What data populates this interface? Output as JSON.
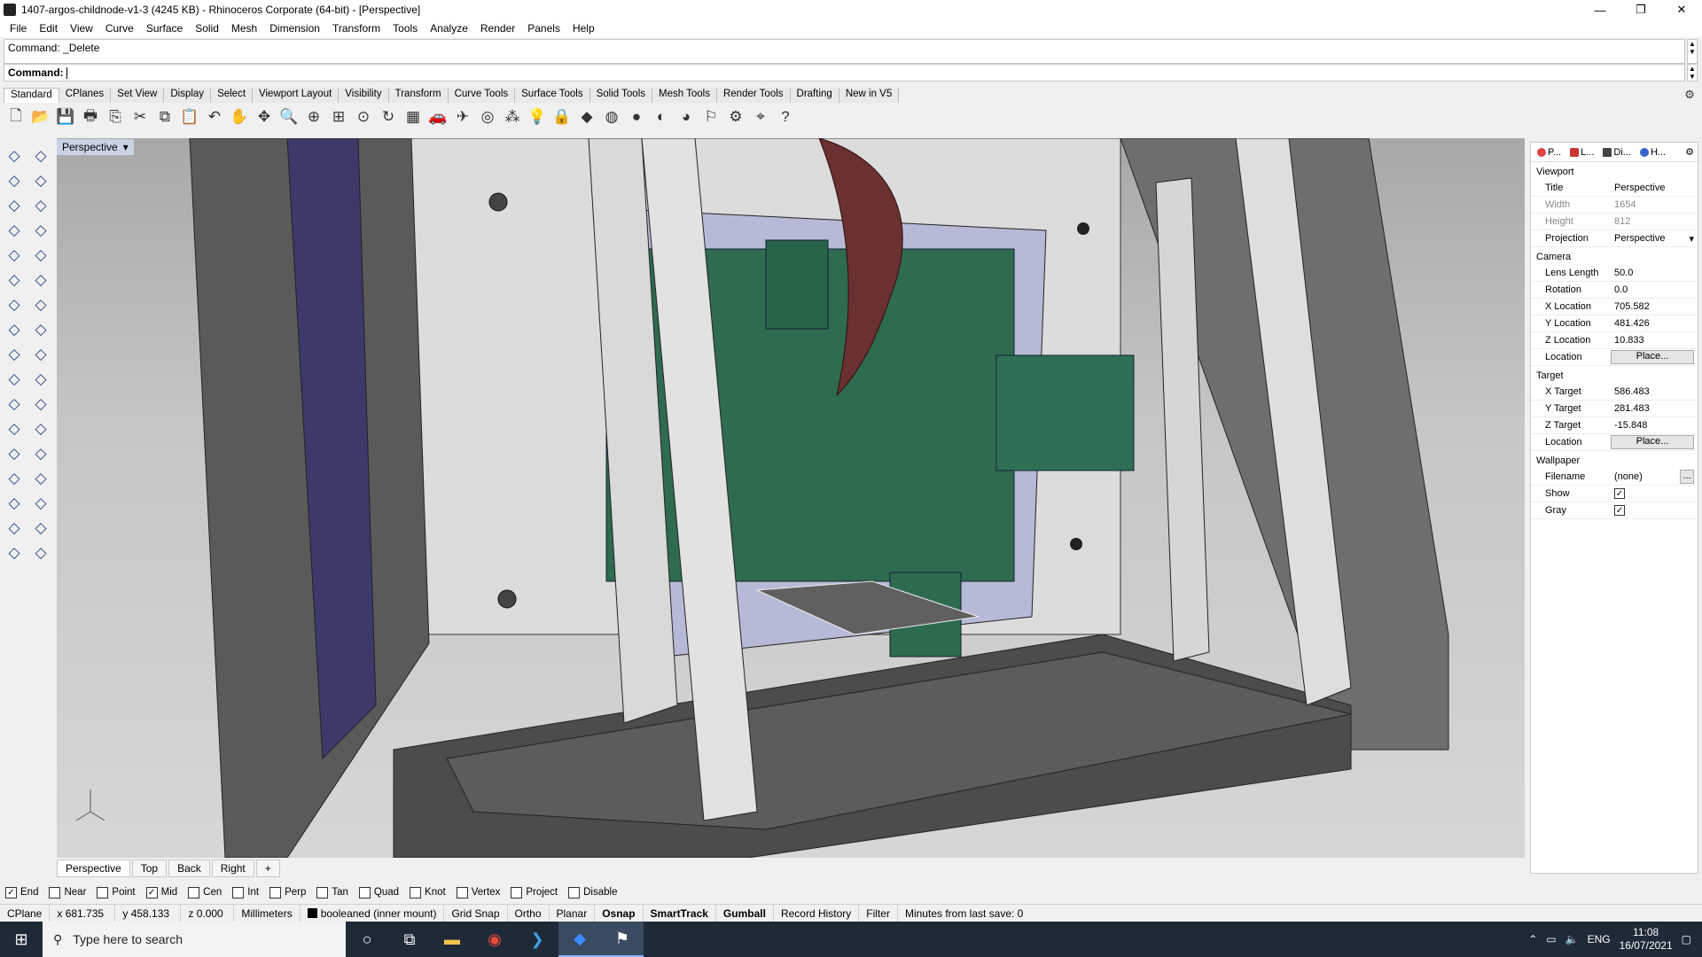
{
  "window": {
    "title": "1407-argos-childnode-v1-3 (4245 KB) - Rhinoceros Corporate (64-bit) - [Perspective]",
    "controls": [
      "minimize-icon",
      "restore-icon",
      "close-icon"
    ]
  },
  "menu": [
    "File",
    "Edit",
    "View",
    "Curve",
    "Surface",
    "Solid",
    "Mesh",
    "Dimension",
    "Transform",
    "Tools",
    "Analyze",
    "Render",
    "Panels",
    "Help"
  ],
  "command": {
    "history": "Command: _Delete",
    "prompt": "Command:"
  },
  "toolbar_tabs": [
    "Standard",
    "CPlanes",
    "Set View",
    "Display",
    "Select",
    "Viewport Layout",
    "Visibility",
    "Transform",
    "Curve Tools",
    "Surface Tools",
    "Solid Tools",
    "Mesh Tools",
    "Render Tools",
    "Drafting",
    "New in V5"
  ],
  "toolbar_icons": [
    {
      "name": "new-file-icon",
      "glyph": "🗋"
    },
    {
      "name": "open-folder-icon",
      "glyph": "📂"
    },
    {
      "name": "save-icon",
      "glyph": "💾"
    },
    {
      "name": "print-icon",
      "glyph": "🖶"
    },
    {
      "name": "export-icon",
      "glyph": "⎘"
    },
    {
      "name": "cut-icon",
      "glyph": "✂"
    },
    {
      "name": "copy-icon",
      "glyph": "⧉"
    },
    {
      "name": "paste-icon",
      "glyph": "📋"
    },
    {
      "name": "undo-icon",
      "glyph": "↶"
    },
    {
      "name": "pan-hand-icon",
      "glyph": "✋"
    },
    {
      "name": "rotate-view-icon",
      "glyph": "✥"
    },
    {
      "name": "zoom-icon",
      "glyph": "🔍"
    },
    {
      "name": "zoom-window-icon",
      "glyph": "⊕"
    },
    {
      "name": "zoom-extents-icon",
      "glyph": "⊞"
    },
    {
      "name": "zoom-selected-icon",
      "glyph": "⊙"
    },
    {
      "name": "undo-view-icon",
      "glyph": "↻"
    },
    {
      "name": "four-viewports-icon",
      "glyph": "▦"
    },
    {
      "name": "named-views-icon",
      "glyph": "🚗"
    },
    {
      "name": "named-cplanes-icon",
      "glyph": "✈"
    },
    {
      "name": "set-cplane-icon",
      "glyph": "◎"
    },
    {
      "name": "snapshots-icon",
      "glyph": "⁂"
    },
    {
      "name": "light-bulb-icon",
      "glyph": "💡"
    },
    {
      "name": "lock-icon",
      "glyph": "🔒"
    },
    {
      "name": "layer-icon",
      "glyph": "◆"
    },
    {
      "name": "color-wheel-icon",
      "glyph": "◍"
    },
    {
      "name": "shaded-sphere-icon",
      "glyph": "●"
    },
    {
      "name": "rendered-sphere-icon",
      "glyph": "◐"
    },
    {
      "name": "render-icon",
      "glyph": "◕"
    },
    {
      "name": "options-icon",
      "glyph": "⚐"
    },
    {
      "name": "gear-options-icon",
      "glyph": "⚙"
    },
    {
      "name": "grasshopper-icon",
      "glyph": "⌖"
    },
    {
      "name": "help-icon",
      "glyph": "?"
    }
  ],
  "left_tools": [
    "select-arrow-icon",
    "point-icon",
    "polyline-icon",
    "curve-icon",
    "circle-icon",
    "ellipse-icon",
    "polygon-icon",
    "rectangle-icon",
    "arc-icon",
    "curve-edit-icon",
    "surface-corner-icon",
    "surface-edit-icon",
    "box-icon",
    "sphere-icon",
    "cylinder-icon",
    "solid-edit-icon",
    "mesh-icon",
    "explode-icon",
    "boolean-icon",
    "split-icon",
    "fillet-icon",
    "blend-icon",
    "dimension-icon",
    "move-icon",
    "array-icon",
    "gumball-icon",
    "extrude-icon",
    "ruler-icon",
    "grid-array-icon",
    "transform-icon",
    "analyze-icon",
    "checkmark-icon",
    "render-mesh-icon",
    "light-icon"
  ],
  "viewport": {
    "label": "Perspective",
    "tabs": [
      "Perspective",
      "Top",
      "Back",
      "Right"
    ],
    "add_tab": "+"
  },
  "properties": {
    "tabs": [
      "P...",
      "L...",
      "Di...",
      "H..."
    ],
    "viewport_header": "Viewport",
    "viewport": [
      {
        "k": "Title",
        "v": "Perspective",
        "dim": false
      },
      {
        "k": "Width",
        "v": "1654",
        "dim": true
      },
      {
        "k": "Height",
        "v": "812",
        "dim": true
      },
      {
        "k": "Projection",
        "v": "Perspective",
        "dim": false
      }
    ],
    "camera_header": "Camera",
    "camera": [
      {
        "k": "Lens Length",
        "v": "50.0"
      },
      {
        "k": "Rotation",
        "v": "0.0"
      },
      {
        "k": "X Location",
        "v": "705.582"
      },
      {
        "k": "Y Location",
        "v": "481.426"
      },
      {
        "k": "Z Location",
        "v": "10.833"
      }
    ],
    "camera_location_label": "Location",
    "place_button": "Place...",
    "target_header": "Target",
    "target": [
      {
        "k": "X Target",
        "v": "586.483"
      },
      {
        "k": "Y Target",
        "v": "281.483"
      },
      {
        "k": "Z Target",
        "v": "-15.848"
      }
    ],
    "target_location_label": "Location",
    "wallpaper_header": "Wallpaper",
    "filename_label": "Filename",
    "filename_value": "(none)",
    "browse": "...",
    "show_label": "Show",
    "gray_label": "Gray",
    "show_checked": true,
    "gray_checked": true
  },
  "osnaps": [
    {
      "label": "End",
      "checked": true
    },
    {
      "label": "Near",
      "checked": false
    },
    {
      "label": "Point",
      "checked": false
    },
    {
      "label": "Mid",
      "checked": true
    },
    {
      "label": "Cen",
      "checked": false
    },
    {
      "label": "Int",
      "checked": false
    },
    {
      "label": "Perp",
      "checked": false
    },
    {
      "label": "Tan",
      "checked": false
    },
    {
      "label": "Quad",
      "checked": false
    },
    {
      "label": "Knot",
      "checked": false
    },
    {
      "label": "Vertex",
      "checked": false
    },
    {
      "label": "Project",
      "checked": false
    },
    {
      "label": "Disable",
      "checked": false
    }
  ],
  "status": {
    "cplane": "CPlane",
    "x": "x 681.735",
    "y": "y 458.133",
    "z": "z 0.000",
    "units": "Millimeters",
    "layer": "booleaned (inner mount)",
    "grid_snap": "Grid Snap",
    "ortho": "Ortho",
    "planar": "Planar",
    "osnap": "Osnap",
    "smarttrack": "SmartTrack",
    "gumball": "Gumball",
    "record_history": "Record History",
    "filter": "Filter",
    "save_info": "Minutes from last save: 0"
  },
  "taskbar": {
    "search_placeholder": "Type here to search",
    "apps": [
      "cortana-icon",
      "task-view-icon",
      "file-explorer-icon",
      "chrome-icon",
      "vscode-icon",
      "dropbox-icon",
      "rhino-icon"
    ],
    "lang": "ENG",
    "time": "11:08",
    "date": "16/07/2021"
  },
  "colors": {
    "pcb_green": "#2e6b4f",
    "ribbon_cable": "#6b3030",
    "viewport_label_bg": "#c9d3e4",
    "taskbar_bg": "#1f2a38"
  }
}
